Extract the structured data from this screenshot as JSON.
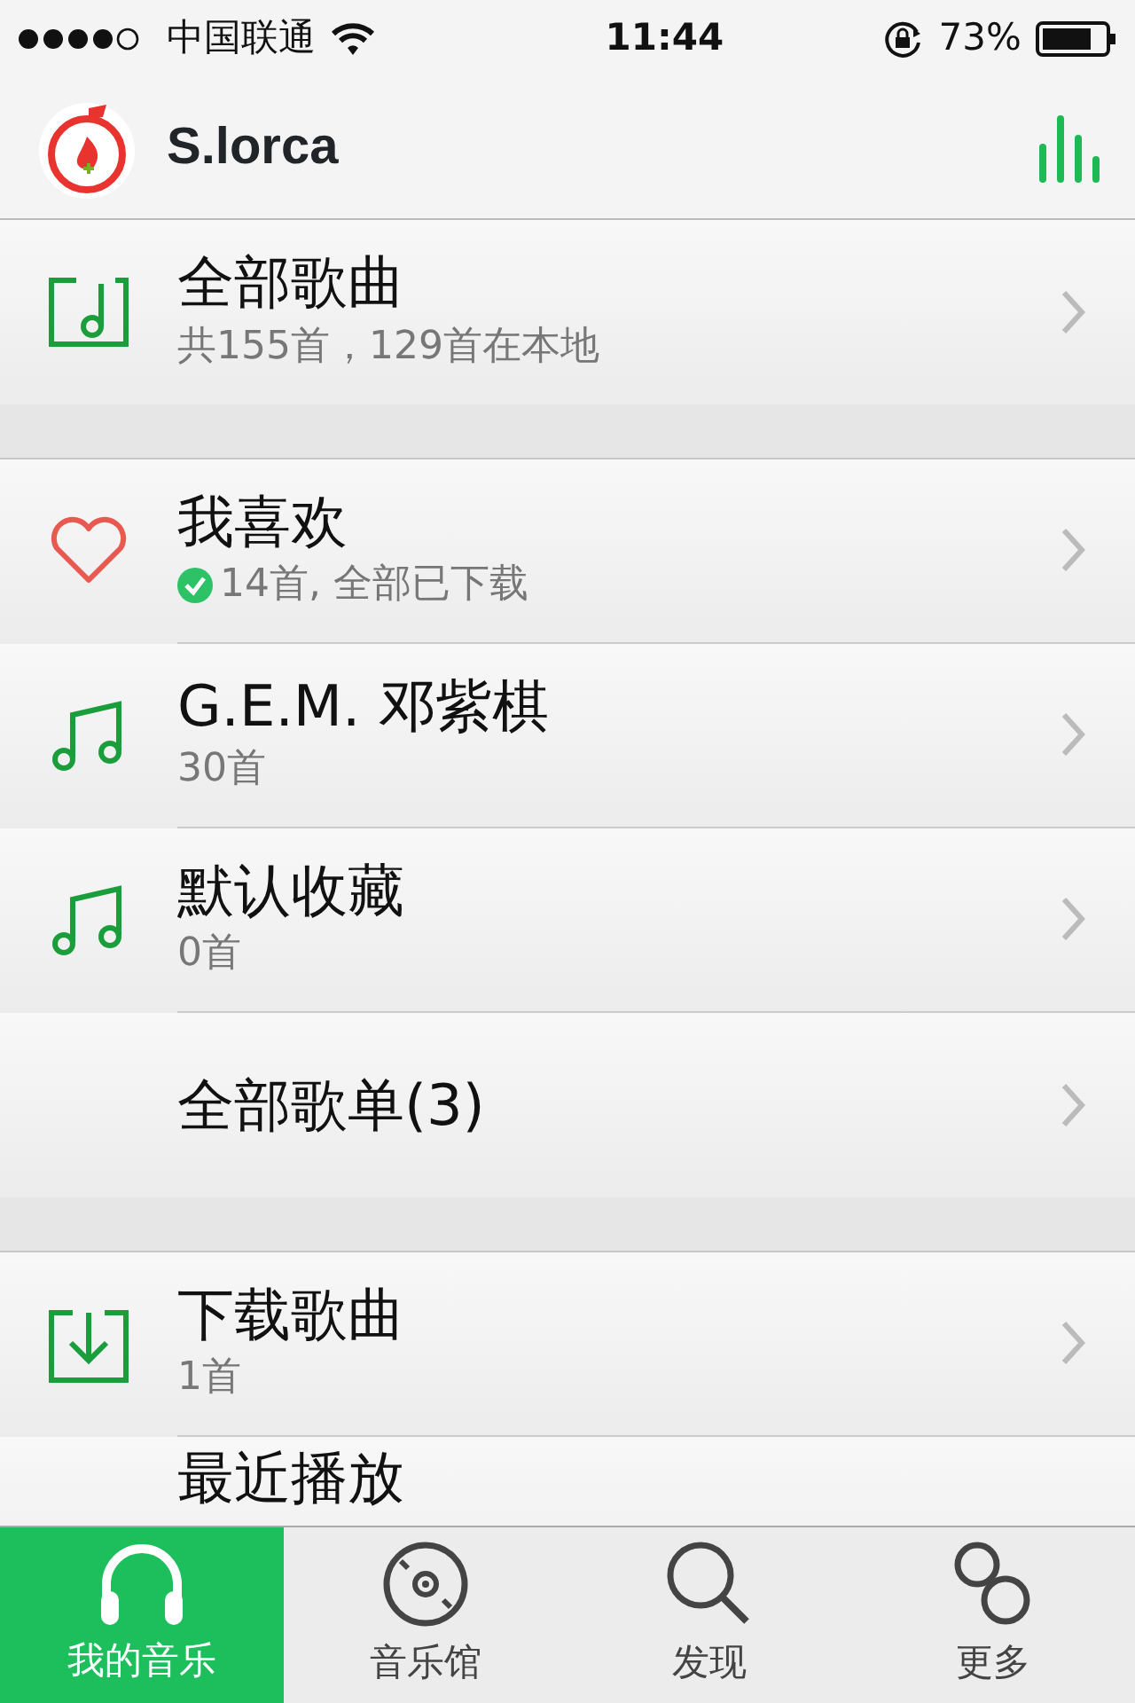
{
  "status_bar": {
    "carrier": "中国联通",
    "time": "11:44",
    "battery": "73%"
  },
  "header": {
    "username": "S.lorca"
  },
  "sections": [
    {
      "rows": [
        {
          "kind": "songs",
          "title": "全部歌曲",
          "subtitle": "共155首，129首在本地",
          "downloaded": false
        }
      ]
    },
    {
      "rows": [
        {
          "kind": "heart",
          "title": "我喜欢",
          "subtitle": "14首, 全部已下载",
          "downloaded": true
        },
        {
          "kind": "note",
          "title": "G.E.M. 邓紫棋",
          "subtitle": "30首",
          "downloaded": false
        },
        {
          "kind": "note",
          "title": "默认收藏",
          "subtitle": "0首",
          "downloaded": false
        },
        {
          "kind": "plain",
          "title": "全部歌单(3)"
        }
      ]
    },
    {
      "rows": [
        {
          "kind": "download",
          "title": "下载歌曲",
          "subtitle": "1首",
          "downloaded": false
        },
        {
          "kind": "plain",
          "title": "最近播放"
        }
      ]
    }
  ],
  "tabs": [
    {
      "label": "我的音乐",
      "kind": "headphones",
      "selected": true
    },
    {
      "label": "音乐馆",
      "kind": "disc",
      "selected": false
    },
    {
      "label": "发现",
      "kind": "search",
      "selected": false
    },
    {
      "label": "更多",
      "kind": "more",
      "selected": false
    }
  ]
}
